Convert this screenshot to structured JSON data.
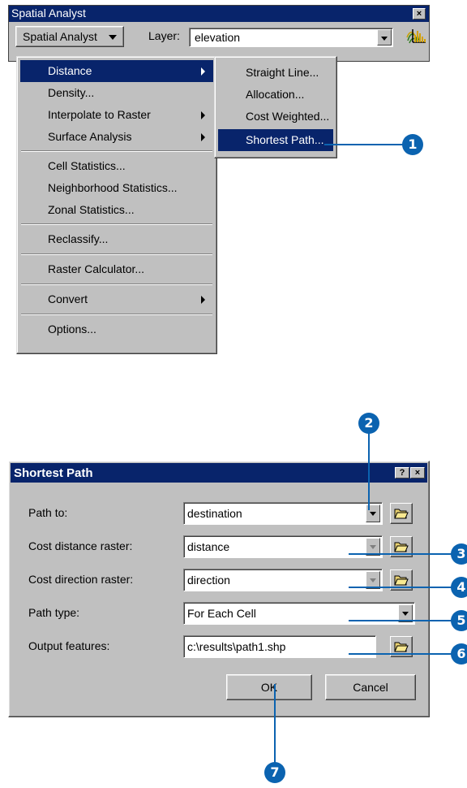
{
  "toolbar": {
    "title": "Spatial Analyst",
    "menu_label": "Spatial Analyst",
    "layer_label": "Layer:",
    "layer_value": "elevation",
    "close_glyph": "×"
  },
  "main_menu": {
    "items": [
      {
        "label": "Distance",
        "submenu": true,
        "selected": true
      },
      {
        "label": "Density...",
        "submenu": false
      },
      {
        "label": "Interpolate to Raster",
        "submenu": true
      },
      {
        "label": "Surface Analysis",
        "submenu": true
      },
      {
        "label": "Cell Statistics...",
        "submenu": false
      },
      {
        "label": "Neighborhood Statistics...",
        "submenu": false
      },
      {
        "label": "Zonal Statistics...",
        "submenu": false
      },
      {
        "label": "Reclassify...",
        "submenu": false
      },
      {
        "label": "Raster Calculator...",
        "submenu": false
      },
      {
        "label": "Convert",
        "submenu": true
      },
      {
        "label": "Options...",
        "submenu": false
      }
    ]
  },
  "sub_menu": {
    "items": [
      {
        "label": "Straight Line..."
      },
      {
        "label": "Allocation..."
      },
      {
        "label": "Cost Weighted..."
      },
      {
        "label": "Shortest Path...",
        "selected": true
      }
    ]
  },
  "dialog": {
    "title": "Shortest Path",
    "help_glyph": "?",
    "close_glyph": "×",
    "fields": [
      {
        "label": "Path to:",
        "value": "destination"
      },
      {
        "label": "Cost distance raster:",
        "value": "distance"
      },
      {
        "label": "Cost direction raster:",
        "value": "direction"
      },
      {
        "label": "Path type:",
        "value": "For Each Cell"
      },
      {
        "label": "Output features:",
        "value": "c:\\results\\path1.shp"
      }
    ],
    "ok_label": "OK",
    "cancel_label": "Cancel"
  },
  "callouts": [
    "1",
    "2",
    "3",
    "4",
    "5",
    "6",
    "7"
  ],
  "colors": {
    "accent": "#0b63b0",
    "selection": "#08246b",
    "window": "#c0c0c0"
  }
}
